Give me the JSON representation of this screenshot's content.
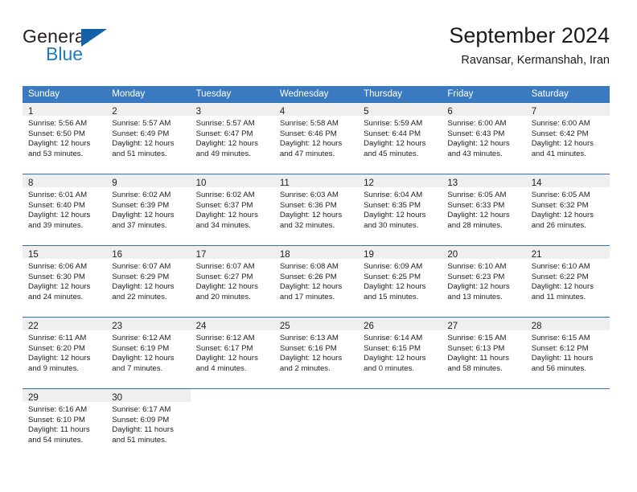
{
  "brand": {
    "name_top": "General",
    "name_bottom": "Blue",
    "logo_icon": "blue-triangle-flag-icon",
    "color": "#1d7bc1"
  },
  "header": {
    "title": "September 2024",
    "subtitle": "Ravansar, Kermanshah, Iran"
  },
  "theme": {
    "header_bg": "#3a7ac0",
    "row_rule": "#2f6fb5",
    "daynum_bg": "#efefef"
  },
  "weekdays": [
    "Sunday",
    "Monday",
    "Tuesday",
    "Wednesday",
    "Thursday",
    "Friday",
    "Saturday"
  ],
  "weeks": [
    [
      {
        "day": "1",
        "sunrise": "Sunrise: 5:56 AM",
        "sunset": "Sunset: 6:50 PM",
        "daylight1": "Daylight: 12 hours",
        "daylight2": "and 53 minutes."
      },
      {
        "day": "2",
        "sunrise": "Sunrise: 5:57 AM",
        "sunset": "Sunset: 6:49 PM",
        "daylight1": "Daylight: 12 hours",
        "daylight2": "and 51 minutes."
      },
      {
        "day": "3",
        "sunrise": "Sunrise: 5:57 AM",
        "sunset": "Sunset: 6:47 PM",
        "daylight1": "Daylight: 12 hours",
        "daylight2": "and 49 minutes."
      },
      {
        "day": "4",
        "sunrise": "Sunrise: 5:58 AM",
        "sunset": "Sunset: 6:46 PM",
        "daylight1": "Daylight: 12 hours",
        "daylight2": "and 47 minutes."
      },
      {
        "day": "5",
        "sunrise": "Sunrise: 5:59 AM",
        "sunset": "Sunset: 6:44 PM",
        "daylight1": "Daylight: 12 hours",
        "daylight2": "and 45 minutes."
      },
      {
        "day": "6",
        "sunrise": "Sunrise: 6:00 AM",
        "sunset": "Sunset: 6:43 PM",
        "daylight1": "Daylight: 12 hours",
        "daylight2": "and 43 minutes."
      },
      {
        "day": "7",
        "sunrise": "Sunrise: 6:00 AM",
        "sunset": "Sunset: 6:42 PM",
        "daylight1": "Daylight: 12 hours",
        "daylight2": "and 41 minutes."
      }
    ],
    [
      {
        "day": "8",
        "sunrise": "Sunrise: 6:01 AM",
        "sunset": "Sunset: 6:40 PM",
        "daylight1": "Daylight: 12 hours",
        "daylight2": "and 39 minutes."
      },
      {
        "day": "9",
        "sunrise": "Sunrise: 6:02 AM",
        "sunset": "Sunset: 6:39 PM",
        "daylight1": "Daylight: 12 hours",
        "daylight2": "and 37 minutes."
      },
      {
        "day": "10",
        "sunrise": "Sunrise: 6:02 AM",
        "sunset": "Sunset: 6:37 PM",
        "daylight1": "Daylight: 12 hours",
        "daylight2": "and 34 minutes."
      },
      {
        "day": "11",
        "sunrise": "Sunrise: 6:03 AM",
        "sunset": "Sunset: 6:36 PM",
        "daylight1": "Daylight: 12 hours",
        "daylight2": "and 32 minutes."
      },
      {
        "day": "12",
        "sunrise": "Sunrise: 6:04 AM",
        "sunset": "Sunset: 6:35 PM",
        "daylight1": "Daylight: 12 hours",
        "daylight2": "and 30 minutes."
      },
      {
        "day": "13",
        "sunrise": "Sunrise: 6:05 AM",
        "sunset": "Sunset: 6:33 PM",
        "daylight1": "Daylight: 12 hours",
        "daylight2": "and 28 minutes."
      },
      {
        "day": "14",
        "sunrise": "Sunrise: 6:05 AM",
        "sunset": "Sunset: 6:32 PM",
        "daylight1": "Daylight: 12 hours",
        "daylight2": "and 26 minutes."
      }
    ],
    [
      {
        "day": "15",
        "sunrise": "Sunrise: 6:06 AM",
        "sunset": "Sunset: 6:30 PM",
        "daylight1": "Daylight: 12 hours",
        "daylight2": "and 24 minutes."
      },
      {
        "day": "16",
        "sunrise": "Sunrise: 6:07 AM",
        "sunset": "Sunset: 6:29 PM",
        "daylight1": "Daylight: 12 hours",
        "daylight2": "and 22 minutes."
      },
      {
        "day": "17",
        "sunrise": "Sunrise: 6:07 AM",
        "sunset": "Sunset: 6:27 PM",
        "daylight1": "Daylight: 12 hours",
        "daylight2": "and 20 minutes."
      },
      {
        "day": "18",
        "sunrise": "Sunrise: 6:08 AM",
        "sunset": "Sunset: 6:26 PM",
        "daylight1": "Daylight: 12 hours",
        "daylight2": "and 17 minutes."
      },
      {
        "day": "19",
        "sunrise": "Sunrise: 6:09 AM",
        "sunset": "Sunset: 6:25 PM",
        "daylight1": "Daylight: 12 hours",
        "daylight2": "and 15 minutes."
      },
      {
        "day": "20",
        "sunrise": "Sunrise: 6:10 AM",
        "sunset": "Sunset: 6:23 PM",
        "daylight1": "Daylight: 12 hours",
        "daylight2": "and 13 minutes."
      },
      {
        "day": "21",
        "sunrise": "Sunrise: 6:10 AM",
        "sunset": "Sunset: 6:22 PM",
        "daylight1": "Daylight: 12 hours",
        "daylight2": "and 11 minutes."
      }
    ],
    [
      {
        "day": "22",
        "sunrise": "Sunrise: 6:11 AM",
        "sunset": "Sunset: 6:20 PM",
        "daylight1": "Daylight: 12 hours",
        "daylight2": "and 9 minutes."
      },
      {
        "day": "23",
        "sunrise": "Sunrise: 6:12 AM",
        "sunset": "Sunset: 6:19 PM",
        "daylight1": "Daylight: 12 hours",
        "daylight2": "and 7 minutes."
      },
      {
        "day": "24",
        "sunrise": "Sunrise: 6:12 AM",
        "sunset": "Sunset: 6:17 PM",
        "daylight1": "Daylight: 12 hours",
        "daylight2": "and 4 minutes."
      },
      {
        "day": "25",
        "sunrise": "Sunrise: 6:13 AM",
        "sunset": "Sunset: 6:16 PM",
        "daylight1": "Daylight: 12 hours",
        "daylight2": "and 2 minutes."
      },
      {
        "day": "26",
        "sunrise": "Sunrise: 6:14 AM",
        "sunset": "Sunset: 6:15 PM",
        "daylight1": "Daylight: 12 hours",
        "daylight2": "and 0 minutes."
      },
      {
        "day": "27",
        "sunrise": "Sunrise: 6:15 AM",
        "sunset": "Sunset: 6:13 PM",
        "daylight1": "Daylight: 11 hours",
        "daylight2": "and 58 minutes."
      },
      {
        "day": "28",
        "sunrise": "Sunrise: 6:15 AM",
        "sunset": "Sunset: 6:12 PM",
        "daylight1": "Daylight: 11 hours",
        "daylight2": "and 56 minutes."
      }
    ],
    [
      {
        "day": "29",
        "sunrise": "Sunrise: 6:16 AM",
        "sunset": "Sunset: 6:10 PM",
        "daylight1": "Daylight: 11 hours",
        "daylight2": "and 54 minutes."
      },
      {
        "day": "30",
        "sunrise": "Sunrise: 6:17 AM",
        "sunset": "Sunset: 6:09 PM",
        "daylight1": "Daylight: 11 hours",
        "daylight2": "and 51 minutes."
      },
      {
        "day": "",
        "sunrise": "",
        "sunset": "",
        "daylight1": "",
        "daylight2": ""
      },
      {
        "day": "",
        "sunrise": "",
        "sunset": "",
        "daylight1": "",
        "daylight2": ""
      },
      {
        "day": "",
        "sunrise": "",
        "sunset": "",
        "daylight1": "",
        "daylight2": ""
      },
      {
        "day": "",
        "sunrise": "",
        "sunset": "",
        "daylight1": "",
        "daylight2": ""
      },
      {
        "day": "",
        "sunrise": "",
        "sunset": "",
        "daylight1": "",
        "daylight2": ""
      }
    ]
  ]
}
